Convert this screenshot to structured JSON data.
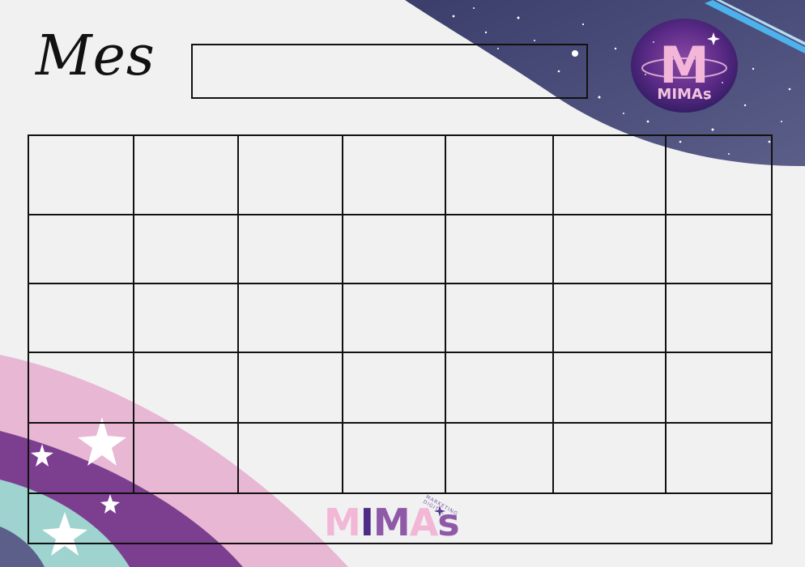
{
  "header": {
    "title": "Mes",
    "month_value": ""
  },
  "calendar": {
    "rows": 5,
    "columns": 7
  },
  "logo": {
    "badge_letter": "M",
    "badge_text": "MIMAs",
    "footer_letters": [
      "M",
      "I",
      "M",
      "A",
      "s"
    ],
    "footer_tagline": "MARKETING DIGITAL"
  },
  "colors": {
    "paper": "#f1f1f1",
    "space": "#4b4d78",
    "pink": "#e8b7d3",
    "purple": "#7c3f8f",
    "teal": "#9fd3cf",
    "footer_pink": "#f2b6d6",
    "footer_purple": "#4b2d86",
    "footer_violet": "#8e5aa8"
  }
}
